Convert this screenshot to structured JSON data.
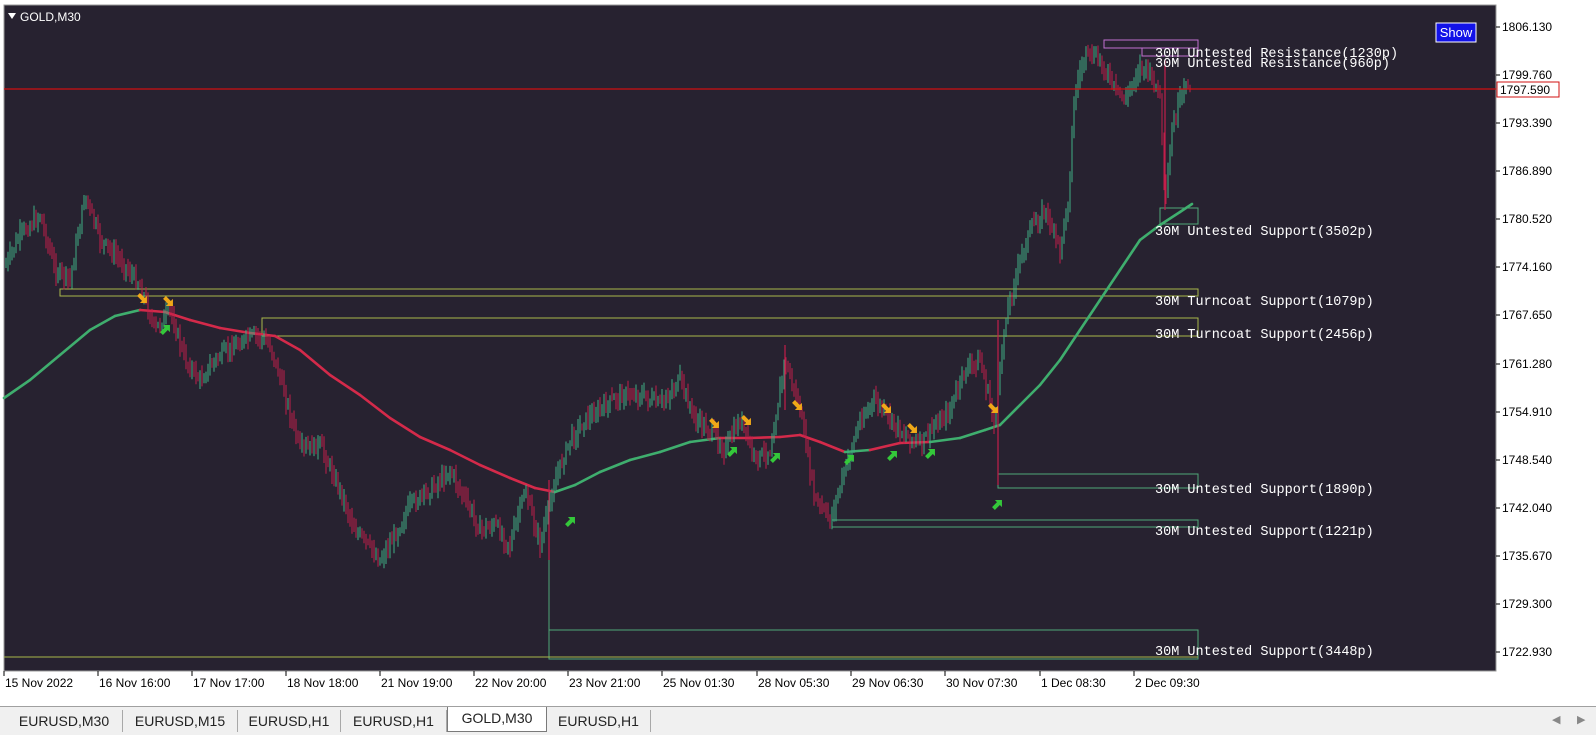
{
  "window": {
    "title": "GOLD,M30",
    "show_button": "Show",
    "price_scale": [
      "1806.130",
      "1799.760",
      "1793.390",
      "1786.890",
      "1780.520",
      "1774.160",
      "1767.650",
      "1761.280",
      "1754.910",
      "1748.540",
      "1742.040",
      "1735.670",
      "1729.300",
      "1722.930"
    ],
    "current_price": "1797.590",
    "time_labels": [
      "15 Nov 2022",
      "16 Nov 16:00",
      "17 Nov 17:00",
      "18 Nov 18:00",
      "21 Nov 19:00",
      "22 Nov 20:00",
      "23 Nov 21:00",
      "25 Nov 01:30",
      "28 Nov 05:30",
      "29 Nov 06:30",
      "30 Nov 07:30",
      "1 Dec 08:30",
      "2 Dec 09:30"
    ]
  },
  "zones": [
    {
      "label": "30M Untested Resistance(1230p)"
    },
    {
      "label": "30M Untested Resistance(960p)"
    },
    {
      "label": "30M Untested Support(3502p)"
    },
    {
      "label": "30M Turncoat Support(1079p)"
    },
    {
      "label": "30M Turncoat Support(2456p)"
    },
    {
      "label": "30M Untested Support(1890p)"
    },
    {
      "label": "30M Untested Support(1221p)"
    },
    {
      "label": "30M Untested Support(3448p)"
    }
  ],
  "tabs": [
    {
      "label": "EURUSD,M30",
      "active": false
    },
    {
      "label": "EURUSD,M15",
      "active": false
    },
    {
      "label": "EURUSD,H1",
      "active": false
    },
    {
      "label": "EURUSD,H1",
      "active": false
    },
    {
      "label": "GOLD,M30",
      "active": true
    },
    {
      "label": "EURUSD,H1",
      "active": false
    }
  ],
  "colors": {
    "chart_bg": "#272230",
    "bull": "#3fae84",
    "bear": "#c21e4a",
    "ma_green": "#3fae6e",
    "ma_red": "#d42a4a",
    "resistance_zone": "#c070d0",
    "support_zone": "#4fa878",
    "turncoat_zone": "#a8b84a",
    "price_line": "#d01010",
    "arrow_up": "#34c83a",
    "arrow_down": "#f0a818"
  }
}
